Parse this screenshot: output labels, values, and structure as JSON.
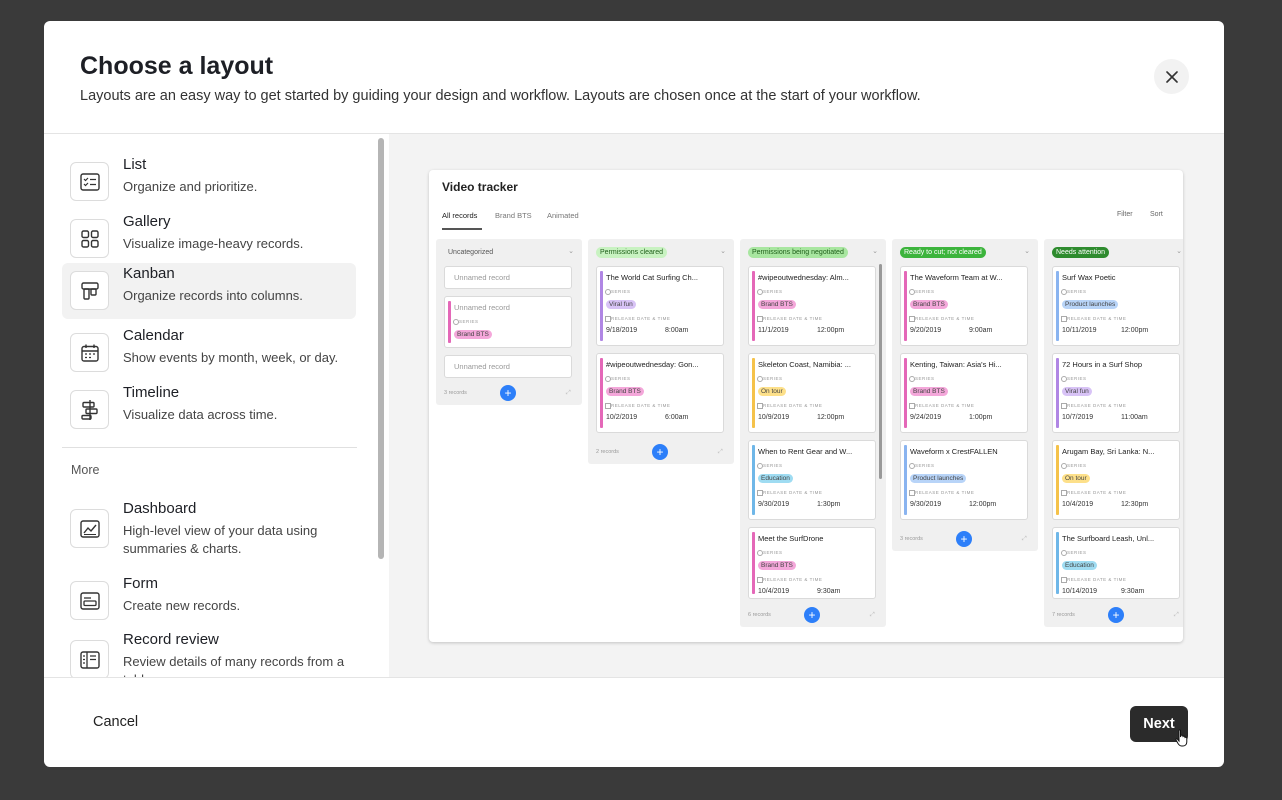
{
  "dialog": {
    "title": "Choose a layout",
    "subtitle": "Layouts are an easy way to get started by guiding your design and workflow. Layouts are chosen once at the start of your workflow.",
    "close_icon": "close-icon"
  },
  "layouts": [
    {
      "label": "List",
      "desc": "Organize and prioritize.",
      "icon": "list-checklist-icon",
      "selected": false
    },
    {
      "label": "Gallery",
      "desc": "Visualize image-heavy records.",
      "icon": "gallery-grid-icon",
      "selected": false
    },
    {
      "label": "Kanban",
      "desc": "Organize records into columns.",
      "icon": "kanban-icon",
      "selected": true
    },
    {
      "label": "Calendar",
      "desc": "Show events by month, week, or day.",
      "icon": "calendar-icon",
      "selected": false
    },
    {
      "label": "Timeline",
      "desc": "Visualize data across time.",
      "icon": "timeline-icon",
      "selected": false
    }
  ],
  "more_label": "More",
  "more_layouts": [
    {
      "label": "Dashboard",
      "desc": "High-level view of your data using summaries & charts.",
      "icon": "dashboard-chart-icon"
    },
    {
      "label": "Form",
      "desc": "Create new records.",
      "icon": "form-icon"
    },
    {
      "label": "Record review",
      "desc": "Review details of many records from a table.",
      "icon": "record-review-icon"
    }
  ],
  "preview": {
    "title": "Video tracker",
    "tabs": [
      "All records",
      "Brand BTS",
      "Animated"
    ],
    "controls": [
      "Filter",
      "Sort"
    ],
    "meta_series": "SERIES",
    "meta_release": "RELEASE DATE & TIME",
    "columns": [
      {
        "header": "Uncategorized",
        "header_bg": "transparent",
        "header_fg": "#555",
        "count": "3 records",
        "cards": [
          {
            "title": "Unnamed record",
            "muted": true,
            "simple": true
          },
          {
            "title": "Unnamed record",
            "muted": true,
            "bar": "#e468b8",
            "tag": "Brand BTS",
            "tag_bg": "#f4a7da",
            "no_date": true
          },
          {
            "title": "Unnamed record",
            "muted": true,
            "simple": true
          }
        ]
      },
      {
        "header": "Permissions cleared",
        "header_bg": "#c8f2c1",
        "header_fg": "#1f5f1a",
        "count": "2 records",
        "cards": [
          {
            "title": "The World Cat Surfing Ch...",
            "bar": "#b086e4",
            "tag": "Viral fun",
            "tag_bg": "#d8c3f6",
            "date": "9/18/2019",
            "time": "8:00am"
          },
          {
            "title": "#wipeoutwednesday: Gon...",
            "bar": "#e468b8",
            "tag": "Brand BTS",
            "tag_bg": "#f4a7da",
            "date": "10/2/2019",
            "time": "6:00am"
          }
        ]
      },
      {
        "header": "Permissions being negotiated",
        "header_bg": "#a8e6a0",
        "header_fg": "#1f5f1a",
        "count": "6 records",
        "cards": [
          {
            "title": "#wipeoutwednesday: Alm...",
            "bar": "#e468b8",
            "tag": "Brand BTS",
            "tag_bg": "#f4a7da",
            "date": "11/1/2019",
            "time": "12:00pm"
          },
          {
            "title": "Skeleton Coast, Namibia: ...",
            "bar": "#f5c24a",
            "tag": "On tour",
            "tag_bg": "#fde08a",
            "date": "10/9/2019",
            "time": "12:00pm"
          },
          {
            "title": "When to Rent Gear and W...",
            "bar": "#6fb7e8",
            "tag": "Education",
            "tag_bg": "#9fdcf2",
            "date": "9/30/2019",
            "time": "1:30pm"
          },
          {
            "title": "Meet the SurfDrone",
            "bar": "#e468b8",
            "tag": "Brand BTS",
            "tag_bg": "#f4a7da",
            "date": "10/4/2019",
            "time": "9:30am"
          }
        ]
      },
      {
        "header": "Ready to cut; not cleared",
        "header_bg": "#3cb43c",
        "header_fg": "#ffffff",
        "count": "3 records",
        "cards": [
          {
            "title": "The Waveform Team at W...",
            "bar": "#e468b8",
            "tag": "Brand BTS",
            "tag_bg": "#f4a7da",
            "date": "9/20/2019",
            "time": "9:00am"
          },
          {
            "title": "Kenting, Taiwan: Asia's Hi...",
            "bar": "#e468b8",
            "tag": "Brand BTS",
            "tag_bg": "#f4a7da",
            "date": "9/24/2019",
            "time": "1:00pm"
          },
          {
            "title": "Waveform x CrestFALLEN",
            "bar": "#8ab4f0",
            "tag": "Product launches",
            "tag_bg": "#b8d4f8",
            "date": "9/30/2019",
            "time": "12:00pm"
          }
        ]
      },
      {
        "header": "Needs attention",
        "header_bg": "#2e8b2e",
        "header_fg": "#ffffff",
        "count": "7 records",
        "cards": [
          {
            "title": "Surf Wax Poetic",
            "bar": "#8ab4f0",
            "tag": "Product launches",
            "tag_bg": "#b8d4f8",
            "date": "10/11/2019",
            "time": "12:00pm"
          },
          {
            "title": "72 Hours in a Surf Shop",
            "bar": "#b086e4",
            "tag": "Viral fun",
            "tag_bg": "#d8c3f6",
            "date": "10/7/2019",
            "time": "11:00am"
          },
          {
            "title": "Arugam Bay, Sri Lanka: N...",
            "bar": "#f5c24a",
            "tag": "On tour",
            "tag_bg": "#fde08a",
            "date": "10/4/2019",
            "time": "12:30pm"
          },
          {
            "title": "The Surfboard Leash, Unl...",
            "bar": "#6fb7e8",
            "tag": "Education",
            "tag_bg": "#9fdcf2",
            "date": "10/14/2019",
            "time": "9:30am"
          }
        ]
      }
    ]
  },
  "footer": {
    "cancel_label": "Cancel",
    "next_label": "Next"
  },
  "colors": {
    "accent_blue": "#2d7ff9",
    "next_button": "#2b2b2b",
    "backdrop": "#3a3a3a"
  }
}
